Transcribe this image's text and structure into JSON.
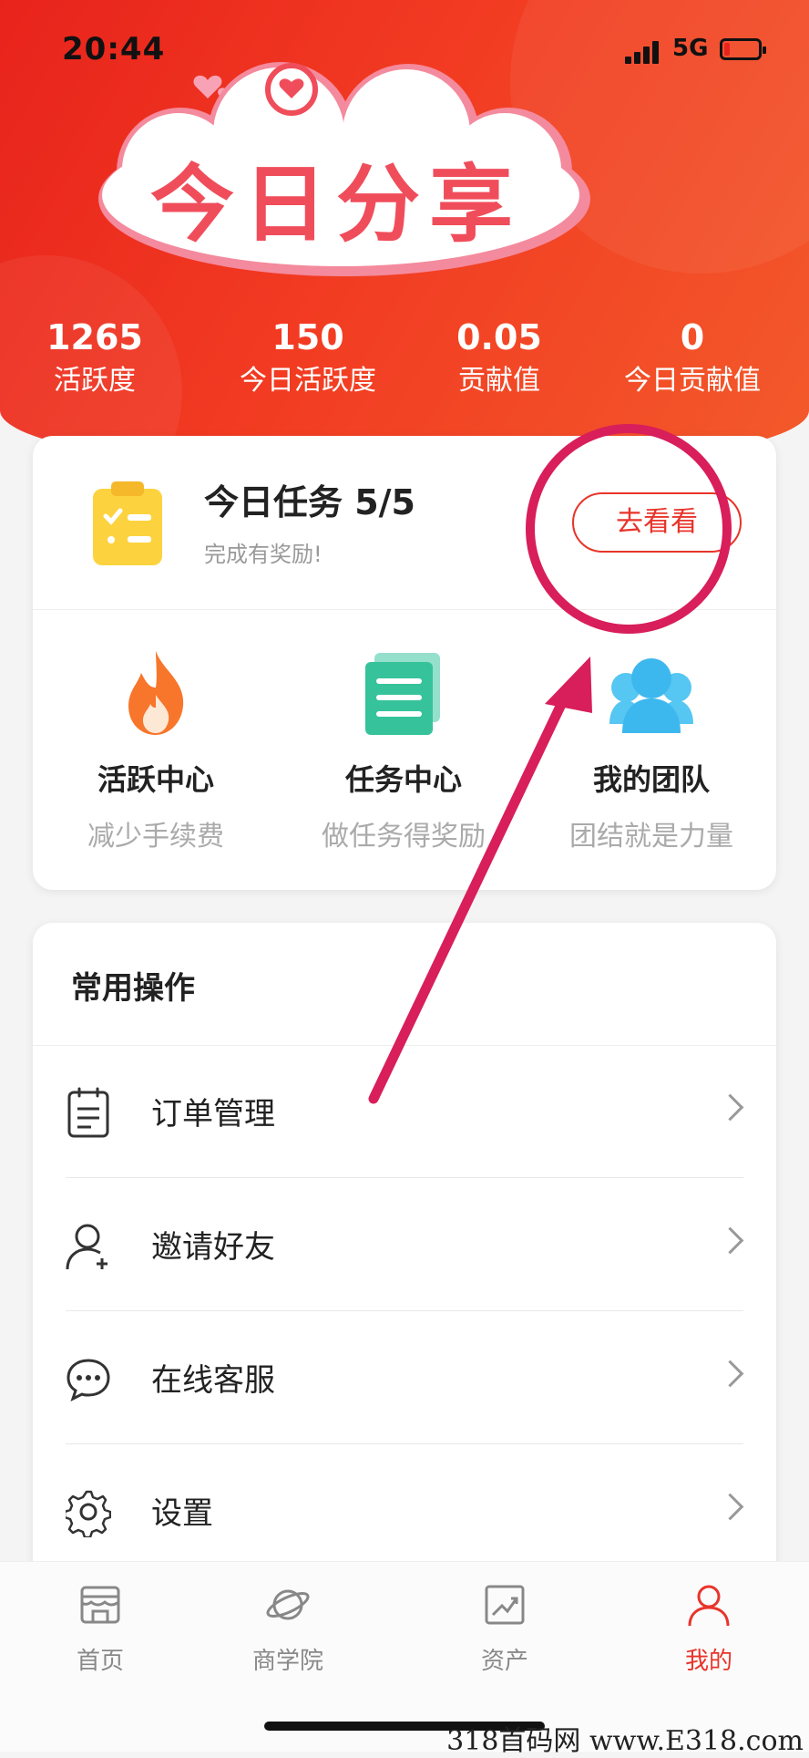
{
  "status": {
    "time": "20:44",
    "network": "5G"
  },
  "banner": {
    "title": "今日分享"
  },
  "stats": [
    {
      "value": "1265",
      "label": "活跃度"
    },
    {
      "value": "150",
      "label": "今日活跃度"
    },
    {
      "value": "0.05",
      "label": "贡献值"
    },
    {
      "value": "0",
      "label": "今日贡献值"
    }
  ],
  "task": {
    "title": "今日任务 5/5",
    "subtitle": "完成有奖励!",
    "button": "去看看"
  },
  "centers": [
    {
      "title": "活跃中心",
      "subtitle": "减少手续费",
      "icon": "flame-icon"
    },
    {
      "title": "任务中心",
      "subtitle": "做任务得奖励",
      "icon": "document-stack-icon"
    },
    {
      "title": "我的团队",
      "subtitle": "团结就是力量",
      "icon": "team-icon"
    }
  ],
  "ops": {
    "title": "常用操作",
    "items": [
      {
        "label": "订单管理",
        "icon": "clipboard-icon"
      },
      {
        "label": "邀请好友",
        "icon": "add-user-icon"
      },
      {
        "label": "在线客服",
        "icon": "chat-bubble-icon"
      },
      {
        "label": "设置",
        "icon": "gear-icon"
      }
    ]
  },
  "tabs": [
    {
      "label": "首页",
      "icon": "store-icon",
      "active": false
    },
    {
      "label": "商学院",
      "icon": "planet-icon",
      "active": false
    },
    {
      "label": "资产",
      "icon": "chart-icon",
      "active": false
    },
    {
      "label": "我的",
      "icon": "person-icon",
      "active": true
    }
  ],
  "watermark": "318首码网 www.E318.com",
  "colors": {
    "accent": "#e8342a",
    "header_start": "#e8231c",
    "header_end": "#f35a2b",
    "annotation": "#d81e5b"
  }
}
